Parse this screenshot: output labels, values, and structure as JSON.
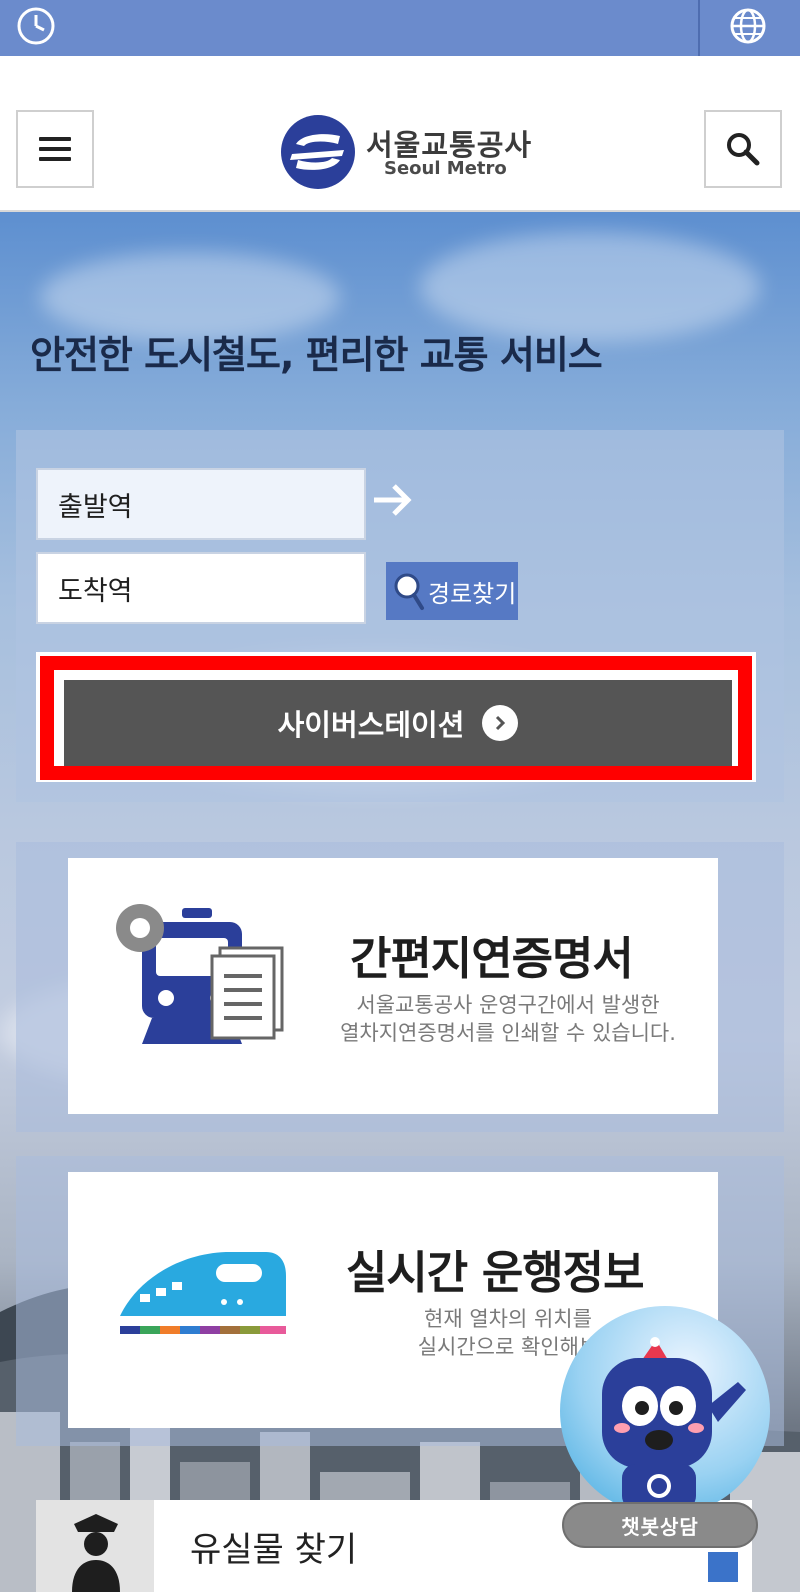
{
  "topbar": {
    "clock_icon": "clock-icon",
    "globe_icon": "globe-icon"
  },
  "header": {
    "menu_icon": "hamburger-menu-icon",
    "search_icon": "search-icon",
    "logo_ko": "서울교통공사",
    "logo_en": "Seoul Metro"
  },
  "hero": {
    "tagline": "안전한 도시철도, 편리한 교통 서비스"
  },
  "route": {
    "departure": "출발역",
    "arrival": "도착역",
    "find_label": "경로찾기",
    "cyber_station": "사이버스테이션"
  },
  "cards": [
    {
      "title": "간편지연증명서",
      "desc1": "서울교통공사 운영구간에서 발생한",
      "desc2": "열차지연증명서를 인쇄할 수 있습니다."
    },
    {
      "title": "실시간 운행정보",
      "desc1": "현재 열차의 위치를",
      "desc2": "실시간으로 확인해보"
    }
  ],
  "lost": {
    "label": "유실물 찾기"
  },
  "chatbot": {
    "label": "챗봇상담"
  },
  "colors": {
    "accent": "#5679c4",
    "highlight": "#ff0000",
    "button_dark": "#555555",
    "train_navy": "#2b3f9a",
    "train_sky": "#29a9e0"
  }
}
